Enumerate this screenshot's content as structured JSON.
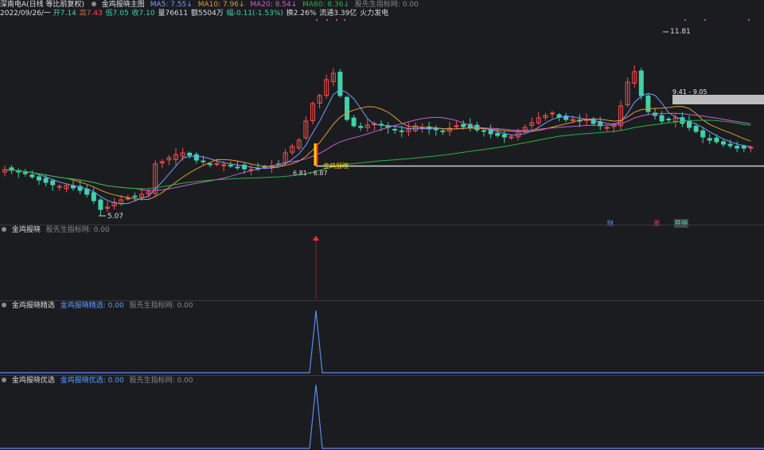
{
  "header": {
    "stock_name": "深南电A(日线 等比前复权)",
    "indicator_name": "金鸡报晓主图",
    "ma5": "MA5: 7.55↓",
    "ma10": "MA10: 7.96↓",
    "ma20": "MA20: 8.54↓",
    "ma60": "MA60: 8.36↓",
    "signal_label": "股先生指标网: 0.00",
    "date": "2022/09/26/一",
    "open_label": "开7.14",
    "high_label": "高7.43",
    "low_label": "低7.05",
    "close_label": "收7.10",
    "volume_label": "量76611",
    "amount_label": "额5504万",
    "change_label": "幅-0.11(-1.53%)",
    "turnover_label": "换2.26%",
    "float_label": "流通3.39亿",
    "tag_label": "火力发电"
  },
  "main_chart": {
    "high_annotation": "11.81",
    "low_annotation": "5.07",
    "range_annotation_right": "9.41 - 9.05",
    "range_annotation_left": "6.81 - 6.87",
    "signal_text": "金鸡报晓",
    "badges": [
      "财",
      "涨",
      "跌停"
    ],
    "colors": {
      "up": "#ff4d4d",
      "down": "#3fd3a7",
      "ma5": "#6fa0ff",
      "ma10": "#e09a30",
      "ma20": "#c85fd0",
      "ma60": "#27b341",
      "signal": "#ffd000"
    }
  },
  "panel1": {
    "title": "金鸡报晓",
    "signal_label": "股先生指标网: 0.00"
  },
  "panel2": {
    "title": "金鸡报晓精选",
    "value_label": "金鸡报晓精选: 0.00",
    "signal_label": "股先生指标网: 0.00"
  },
  "panel3": {
    "title": "金鸡报晓优选",
    "value_label": "金鸡报晓优选: 0.00",
    "signal_label": "股先生指标网: 0.00"
  }
}
